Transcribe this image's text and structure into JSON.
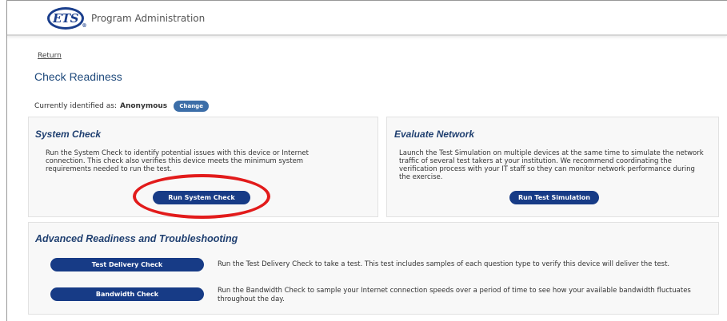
{
  "header": {
    "logo_text": "ETS",
    "logo_reg": "®",
    "app_title": "Program Administration"
  },
  "nav": {
    "return_label": "Return"
  },
  "page": {
    "title": "Check Readiness"
  },
  "identity": {
    "label": "Currently identified as:",
    "user": "Anonymous",
    "change_label": "Change"
  },
  "system_check": {
    "title": "System Check",
    "description": "Run the System Check to identify potential issues with this device or Internet connection. This check also verifies this device meets the minimum system requirements needed to run the test.",
    "button_label": "Run System Check"
  },
  "evaluate_network": {
    "title": "Evaluate Network",
    "description": "Launch the Test Simulation on multiple devices at the same time to simulate the network traffic of several test takers at your institution. We recommend coordinating the verification process with your IT staff so they can monitor network performance during the exercise.",
    "button_label": "Run Test Simulation"
  },
  "advanced": {
    "title": "Advanced Readiness and Troubleshooting",
    "items": [
      {
        "button_label": "Test Delivery Check",
        "description": "Run the Test Delivery Check to take a test. This test includes samples of each question type to verify this device will deliver the test."
      },
      {
        "button_label": "Bandwidth Check",
        "description": "Run the Bandwidth Check to sample your Internet connection speeds over a period of time to see how your available bandwidth fluctuates throughout the day."
      }
    ]
  },
  "colors": {
    "brand": "#1a3e8c",
    "button": "#173b86",
    "highlight": "#e21b1b",
    "title": "#1f4a7c"
  }
}
